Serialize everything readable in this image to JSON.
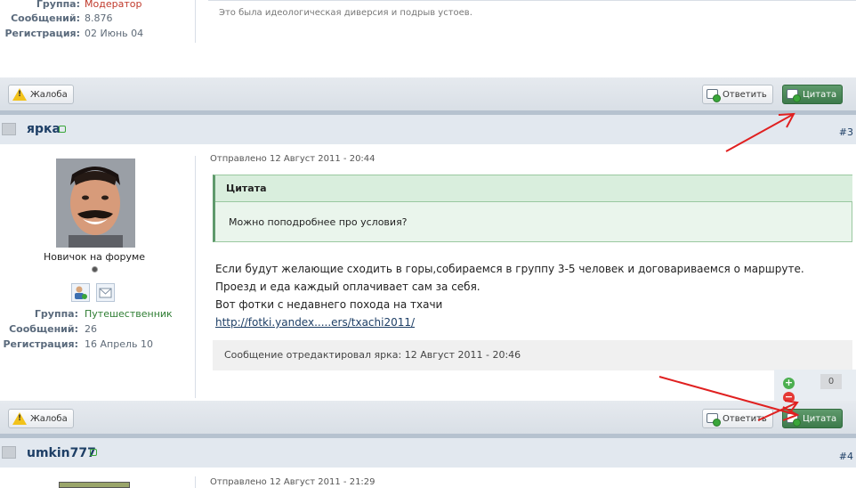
{
  "prev_post": {
    "group_label": "Группа:",
    "group_value": "Модератор",
    "posts_label": "Сообщений:",
    "posts_value": "8.876",
    "reg_label": "Регистрация:",
    "reg_value": "02 Июнь 04",
    "text": "Это была идеологическая диверсия и подрыв устоев."
  },
  "actions": {
    "report_label": "Жалоба",
    "reply_label": "Ответить",
    "quote_label": "Цитата"
  },
  "post3": {
    "username": "ярка",
    "number": "#3",
    "posted": "Отправлено 12 Август 2011 - 20:44",
    "rank": "Новичок на форуме",
    "group_label": "Группа:",
    "group_value": "Путешественник",
    "posts_label": "Сообщений:",
    "posts_value": "26",
    "reg_label": "Регистрация:",
    "reg_value": "16 Апрель 10",
    "quote_title": "Цитата",
    "quote_text": "Можно поподробнее про условия?",
    "lines": [
      "Если будут желающие сходить в горы,собираемся в группу 3-5 человек и договариваемся о маршруте.",
      "Проезд и еда каждый оплачивает сам за себя.",
      "Вот фотки с недавнего похода на тхачи"
    ],
    "link": "http://fotki.yandex.....ers/txachi2011/",
    "edited": "Сообщение отредактировал ярка: 12 Август 2011 - 20:46",
    "rating": "0"
  },
  "post4": {
    "username": "umkin777",
    "number": "#4",
    "posted": "Отправлено 12 Август 2011 - 21:29"
  },
  "colors": {
    "moderator": "#c0392b",
    "traveler": "#2e7d32",
    "quote_btn": "#3d7a4b",
    "annotation_arrow": "#e02020"
  }
}
